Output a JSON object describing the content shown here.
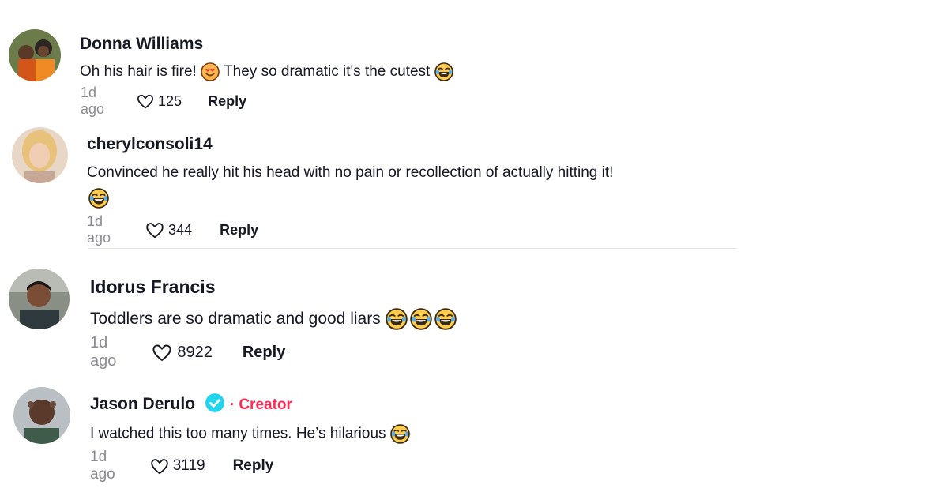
{
  "comments": [
    {
      "username": "Donna Williams",
      "text_a": "Oh his hair is fire! ",
      "text_b": " They so dramatic it's the cutest ",
      "time": "1d ago",
      "likes": "125",
      "reply": "Reply"
    },
    {
      "username": "cherylconsoli14",
      "text_a": "Convinced he really hit his head with no pain or recollection of actually hitting it!",
      "time": "1d ago",
      "likes": "344",
      "reply": "Reply"
    },
    {
      "username": "Idorus Francis",
      "text_a": "Toddlers are so dramatic and good liars ",
      "time": "1d ago",
      "likes": "8922",
      "reply": "Reply"
    },
    {
      "username": "Jason Derulo",
      "badge": "· Creator",
      "text_a": "I watched this too many times. He’s hilarious ",
      "time": "1d ago",
      "likes": "3119",
      "reply": "Reply"
    }
  ],
  "colors": {
    "accent": "#fe2c55",
    "verified": "#20d5ec",
    "meta": "#8a8b91"
  },
  "icons": [
    "heart-icon",
    "laughing-emoji",
    "heart-eyes-emoji",
    "verified-badge-icon"
  ]
}
